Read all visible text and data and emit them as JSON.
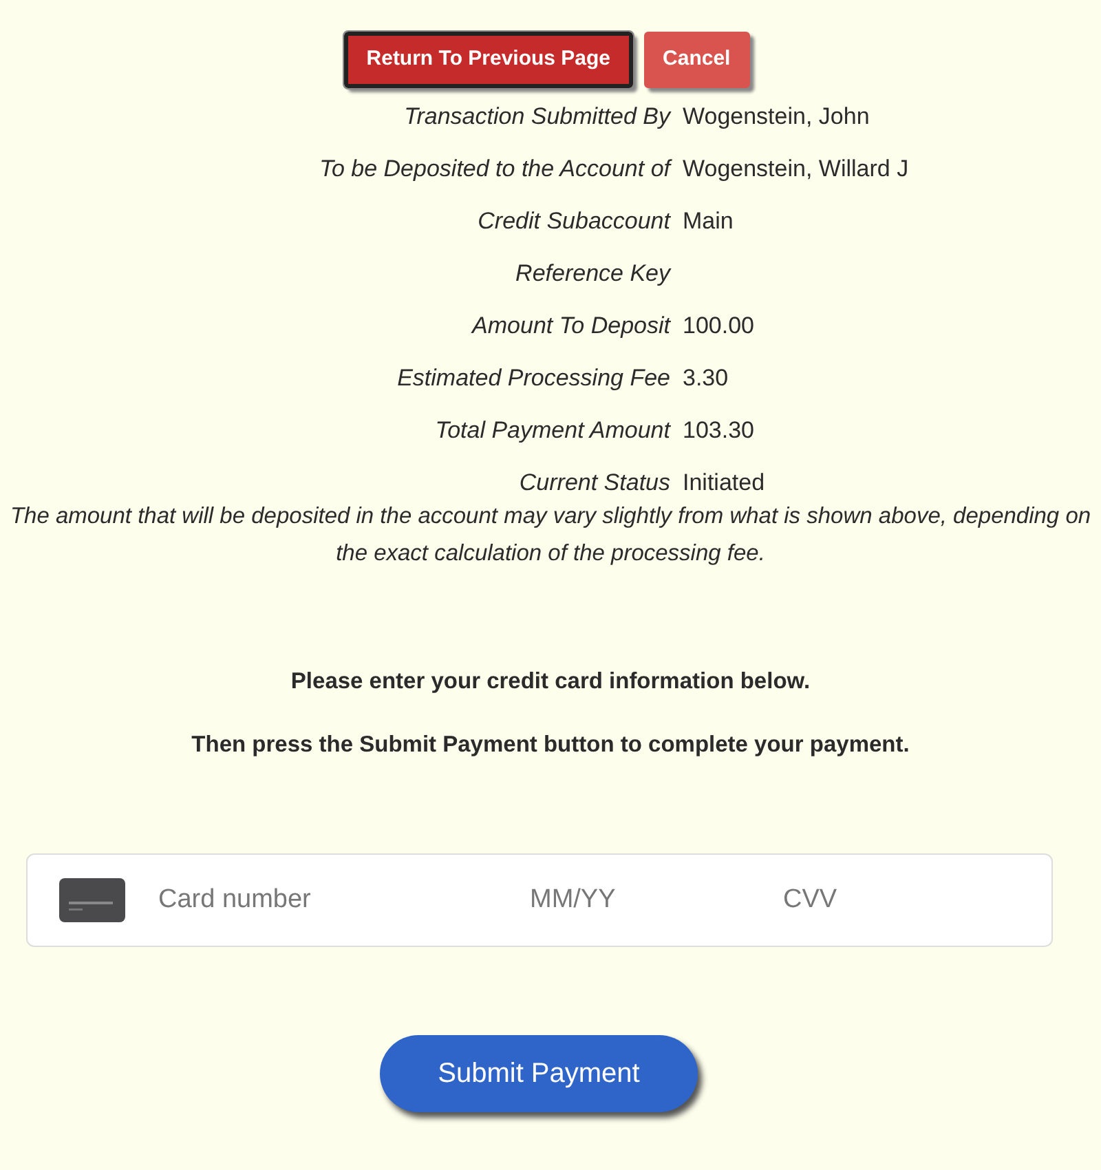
{
  "buttons": [
    {
      "label": "Return To Previous Page",
      "kind": "primary"
    },
    {
      "label": "Cancel",
      "kind": "secondary"
    }
  ],
  "details": [
    {
      "label": "Transaction Submitted By",
      "value": "Wogenstein, John"
    },
    {
      "label": "To be Deposited to the Account of",
      "value": "Wogenstein, Willard J"
    },
    {
      "label": "Credit Subaccount",
      "value": "Main"
    },
    {
      "label": "Reference Key"
    },
    {
      "label": "Amount To Deposit",
      "value": "100.00"
    },
    {
      "label": "Estimated Processing Fee",
      "value": "3.30"
    },
    {
      "label": "Total Payment Amount",
      "value": "103.30"
    },
    {
      "label": "Current Status",
      "value": "Initiated"
    }
  ],
  "note": "The amount that will be deposited in the account may vary slightly from what is shown above, depending on the exact calculation of the processing fee.",
  "instructions": [
    "Please enter your credit card information below.",
    "Then press the Submit Payment button to complete your payment."
  ],
  "card_form": {
    "number_placeholder": "Card number",
    "expiry_placeholder": "MM/YY",
    "cvv_placeholder": "CVV"
  },
  "submit_button": "Submit Payment"
}
